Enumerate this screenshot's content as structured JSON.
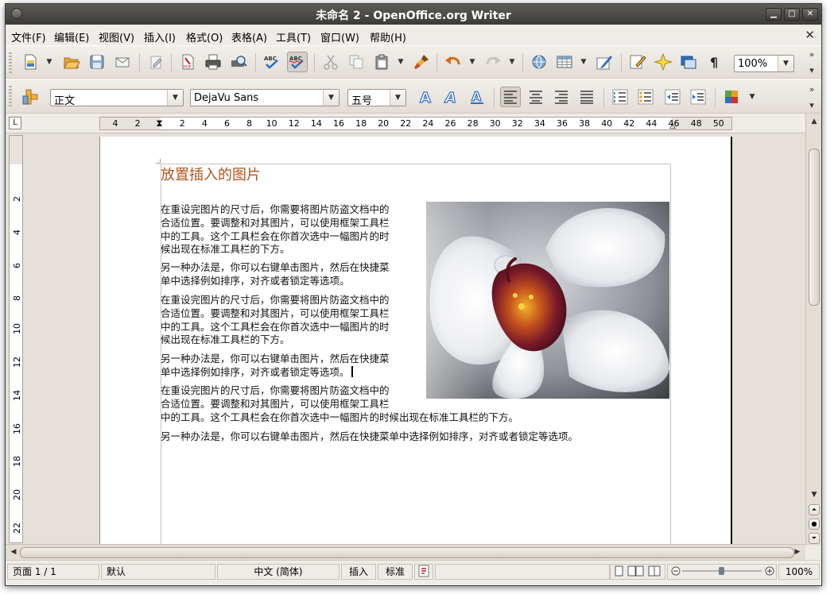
{
  "window": {
    "title": "未命名 2 - OpenOffice.org Writer"
  },
  "menu": [
    {
      "label": "文件(F)"
    },
    {
      "label": "编辑(E)"
    },
    {
      "label": "视图(V)"
    },
    {
      "label": "插入(I)"
    },
    {
      "label": "格式(O)"
    },
    {
      "label": "表格(A)"
    },
    {
      "label": "工具(T)"
    },
    {
      "label": "窗口(W)"
    },
    {
      "label": "帮助(H)"
    }
  ],
  "toolbar": {
    "zoom_value": "100%"
  },
  "format": {
    "style": "正文",
    "font": "DejaVu Sans",
    "size": "五号"
  },
  "ruler": {
    "h_labels": [
      "4",
      "2",
      "2",
      "4",
      "6",
      "8",
      "10",
      "12",
      "14",
      "16",
      "18",
      "20",
      "22",
      "24",
      "26",
      "28",
      "30",
      "32",
      "34",
      "36",
      "38",
      "40",
      "42",
      "44",
      "46",
      "48",
      "50"
    ],
    "v_labels": [
      "2",
      "4",
      "6",
      "8",
      "10",
      "12",
      "14",
      "16",
      "18",
      "20",
      "22"
    ]
  },
  "document": {
    "heading": "放置插入的图片",
    "paragraphs": [
      "在重设完图片的尺寸后，你需要将图片防盗文档中的\n合适位置。要调整和对其图片，可以使用框架工具栏\n中的工具。这个工具栏会在你首次选中一幅图片的时\n候出现在标准工具栏的下方。",
      "另一种办法是，你可以右键单击图片，然后在快捷菜\n单中选择例如排序，对齐或者锁定等选项。",
      "在重设完图片的尺寸后，你需要将图片防盗文档中的\n合适位置。要调整和对其图片，可以使用框架工具栏\n中的工具。这个工具栏会在你首次选中一幅图片的时\n候出现在标准工具栏的下方。",
      "另一种办法是，你可以右键单击图片，然后在快捷菜\n单中选择例如排序，对齐或者锁定等选项。",
      "在重设完图片的尺寸后，你需要将图片防盗文档中的\n合适位置。要调整和对其图片，可以使用框架工具栏\n中的工具。这个工具栏会在你首次选中一幅图片的时候出现在标准工具栏的下方。",
      "另一种办法是，你可以右键单击图片，然后在快捷菜单中选择例如排序，对齐或者锁定等选项。"
    ]
  },
  "status": {
    "page": "页面 1 / 1",
    "style": "默认",
    "language": "中文 (简体)",
    "insert_mode": "插入",
    "selection_mode": "标准",
    "zoom": "100%"
  },
  "colors": {
    "heading": "#b4521b",
    "titlebar": "#3c3b37",
    "chrome": "#efebe7"
  }
}
